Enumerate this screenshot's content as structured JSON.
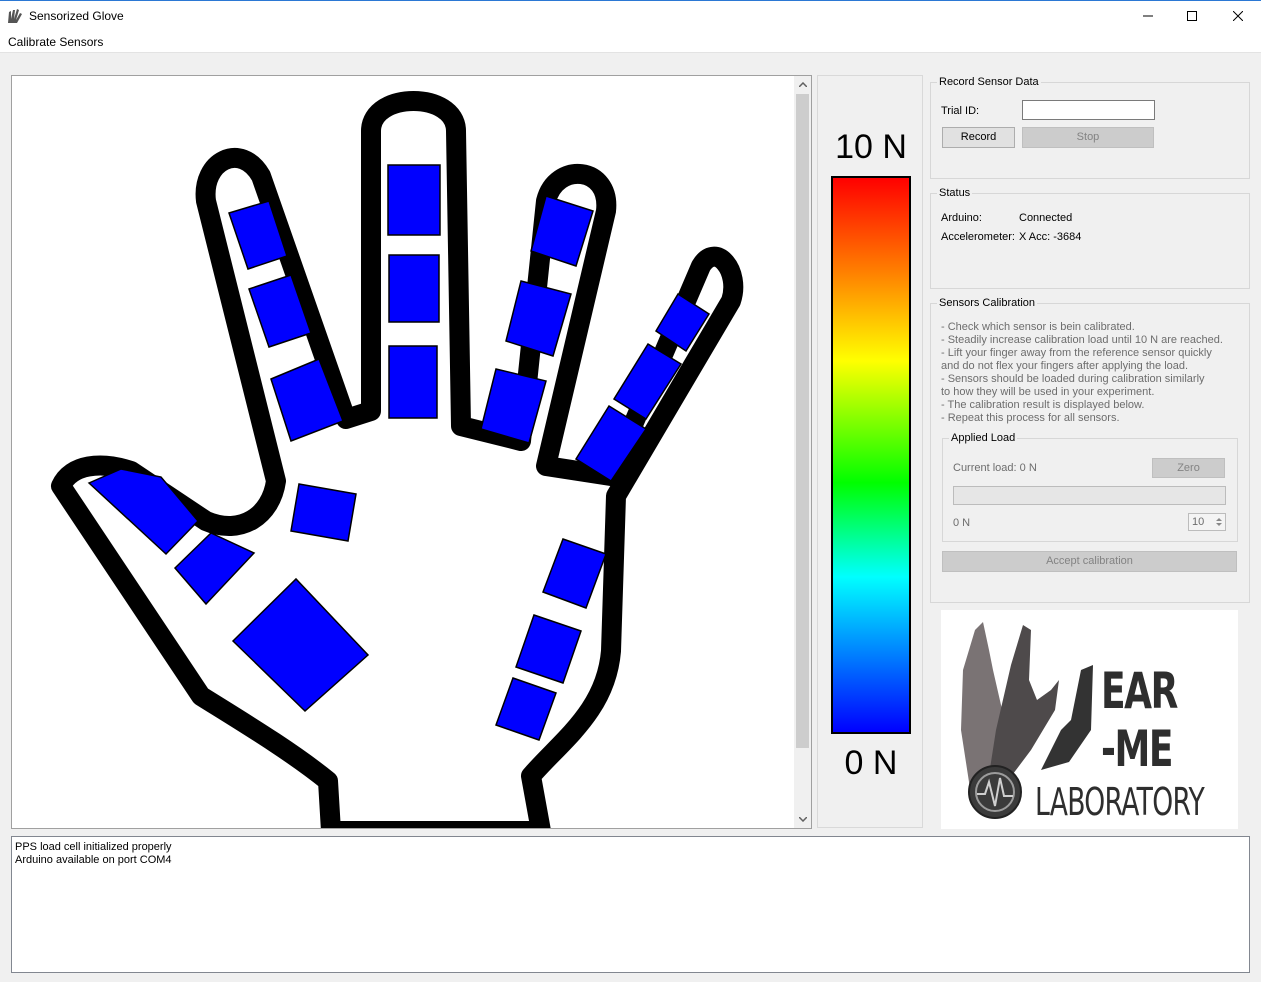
{
  "window": {
    "title": "Sensorized Glove"
  },
  "menu": {
    "items": [
      {
        "label": "Calibrate Sensors"
      }
    ]
  },
  "colorbar": {
    "max_label": "10 N",
    "min_label": "0 N"
  },
  "record": {
    "title": "Record Sensor Data",
    "trial_label": "Trial ID:",
    "trial_value": "",
    "record_label": "Record",
    "stop_label": "Stop"
  },
  "status": {
    "title": "Status",
    "arduino_label": "Arduino:",
    "arduino_value": "Connected",
    "accel_label": "Accelerometer:",
    "accel_value": "X Acc: -3684"
  },
  "calibration": {
    "title": "Sensors Calibration",
    "instructions": [
      "- Check which sensor is bein calibrated.",
      "- Steadily increase calibration load until 10 N are reached.",
      "- Lift your finger away from the reference sensor quickly",
      "and do not flex your fingers after applying the load.",
      "- Sensors should be loaded during calibration similarly",
      "to how they will be used in your experiment.",
      "- The calibration result is displayed below.",
      "- Repeat this process for all sensors."
    ],
    "applied_load": {
      "title": "Applied Load",
      "current_load": "Current load: 0 N",
      "zero_label": "Zero",
      "progress": 0,
      "min_label": "0 N",
      "spin_value": "10"
    },
    "accept_label": "Accept calibration"
  },
  "logo": {
    "line1": "EAR",
    "line2": "-ME",
    "line3": "LABORATORY"
  },
  "log": {
    "lines": [
      "PPS load cell initialized properly",
      "Arduino available on port COM4"
    ]
  },
  "colors": {
    "sensor": "#0000ff",
    "accent": "#2b78d4"
  }
}
